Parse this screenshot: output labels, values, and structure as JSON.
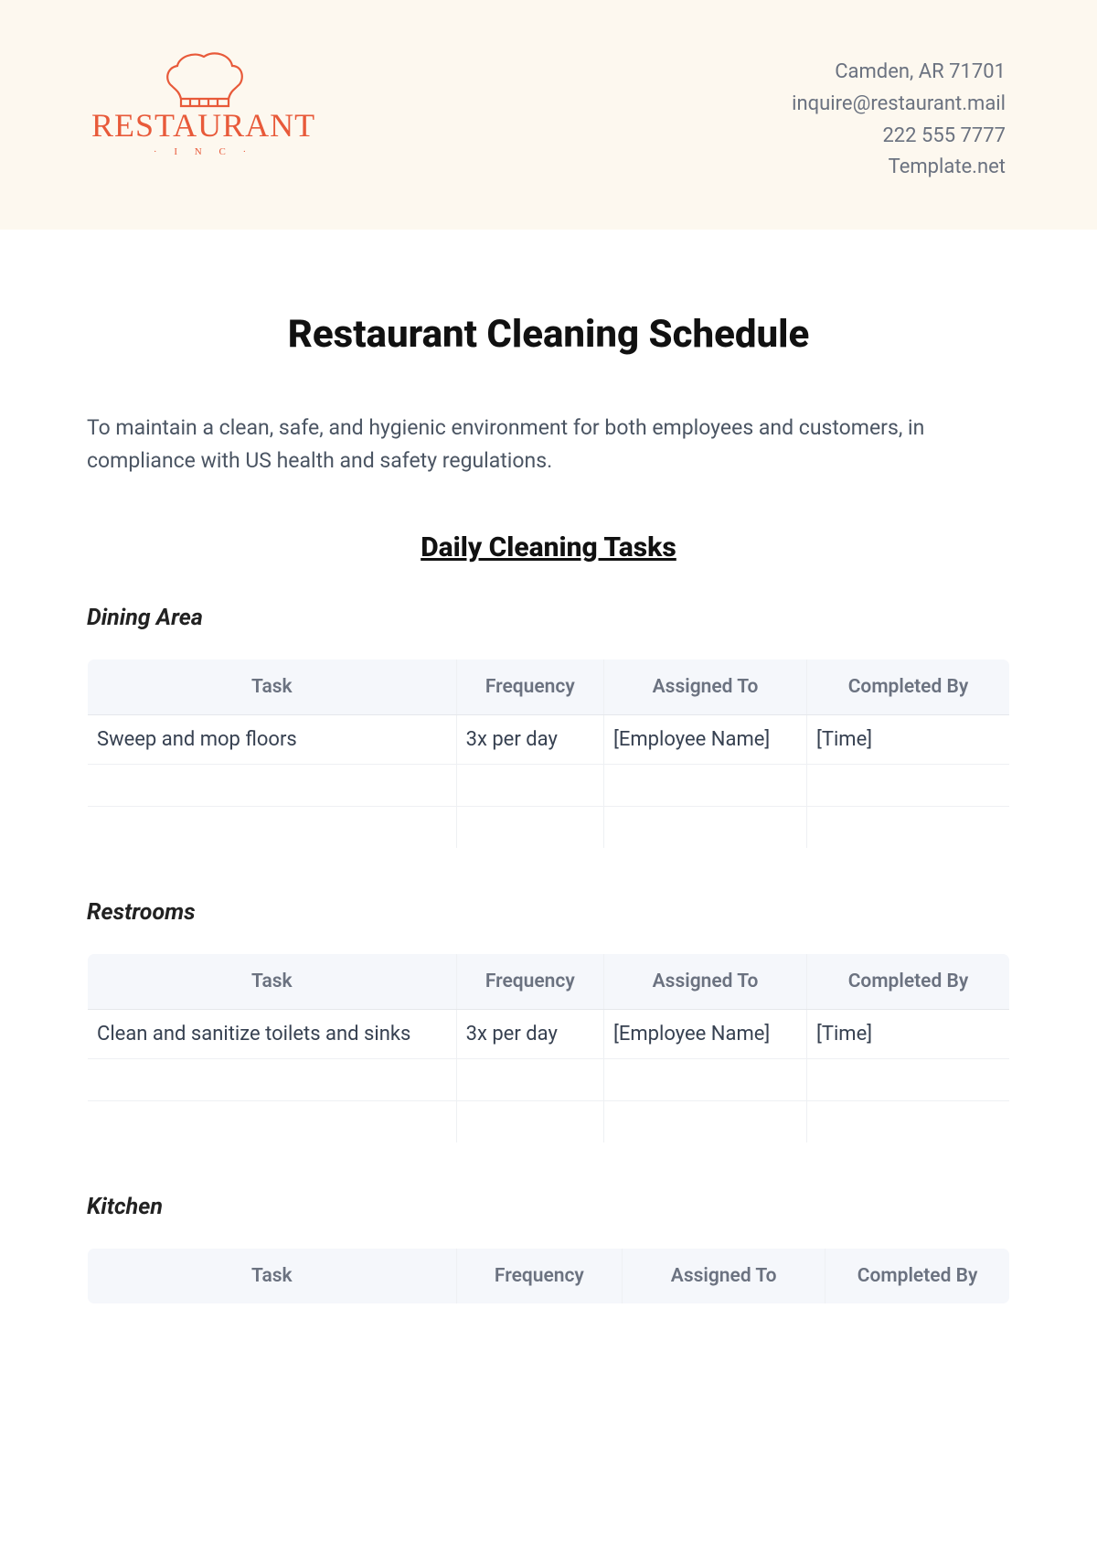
{
  "header": {
    "logo_name": "RESTAURANT",
    "logo_sub": "· I N C ·",
    "contact": {
      "address": "Camden, AR 71701",
      "email": "inquire@restaurant.mail",
      "phone": "222 555 7777",
      "site": "Template.net"
    }
  },
  "title": "Restaurant Cleaning Schedule",
  "intro": "To maintain a clean, safe, and hygienic environment for both employees and customers, in compliance with US health and safety regulations.",
  "section_heading": "Daily Cleaning Tasks",
  "tables": {
    "columns": [
      "Task",
      "Frequency",
      "Assigned To",
      "Completed By"
    ],
    "dining": {
      "heading": "Dining Area",
      "rows": [
        {
          "task": "Sweep and mop floors",
          "frequency": "3x per day",
          "assigned": "[Employee Name]",
          "completed": "[Time]"
        },
        {
          "task": "",
          "frequency": "",
          "assigned": "",
          "completed": ""
        },
        {
          "task": "",
          "frequency": "",
          "assigned": "",
          "completed": ""
        }
      ]
    },
    "restrooms": {
      "heading": "Restrooms",
      "rows": [
        {
          "task": "Clean and sanitize toilets and sinks",
          "frequency": "3x per day",
          "assigned": "[Employee Name]",
          "completed": "[Time]"
        },
        {
          "task": "",
          "frequency": "",
          "assigned": "",
          "completed": ""
        },
        {
          "task": "",
          "frequency": "",
          "assigned": "",
          "completed": ""
        }
      ]
    },
    "kitchen": {
      "heading": "Kitchen",
      "rows": []
    }
  }
}
